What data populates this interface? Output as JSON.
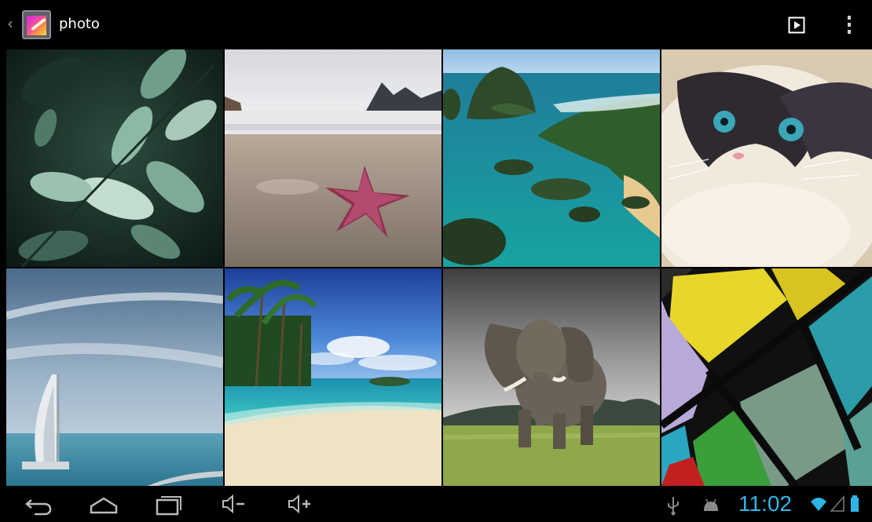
{
  "action_bar": {
    "title": "photo",
    "icons": [
      "up-caret-icon",
      "gallery-app-icon",
      "slideshow-icon",
      "overflow-menu-icon"
    ]
  },
  "photos": [
    {
      "subject": "leaves"
    },
    {
      "subject": "starfish-on-beach"
    },
    {
      "subject": "tropical-island-coast"
    },
    {
      "subject": "cat"
    },
    {
      "subject": "burj-al-arab"
    },
    {
      "subject": "palm-beach"
    },
    {
      "subject": "elephant"
    },
    {
      "subject": "stained-glass"
    }
  ],
  "navigation_bar": {
    "buttons": [
      "back-icon",
      "home-icon",
      "recent-apps-icon",
      "volume-down-icon",
      "volume-up-icon"
    ]
  },
  "status_bar": {
    "time": "11:02",
    "icons": [
      "usb-icon",
      "android-debug-icon",
      "wifi-icon",
      "signal-icon",
      "battery-icon"
    ],
    "accent_color": "#2fb4e6"
  }
}
